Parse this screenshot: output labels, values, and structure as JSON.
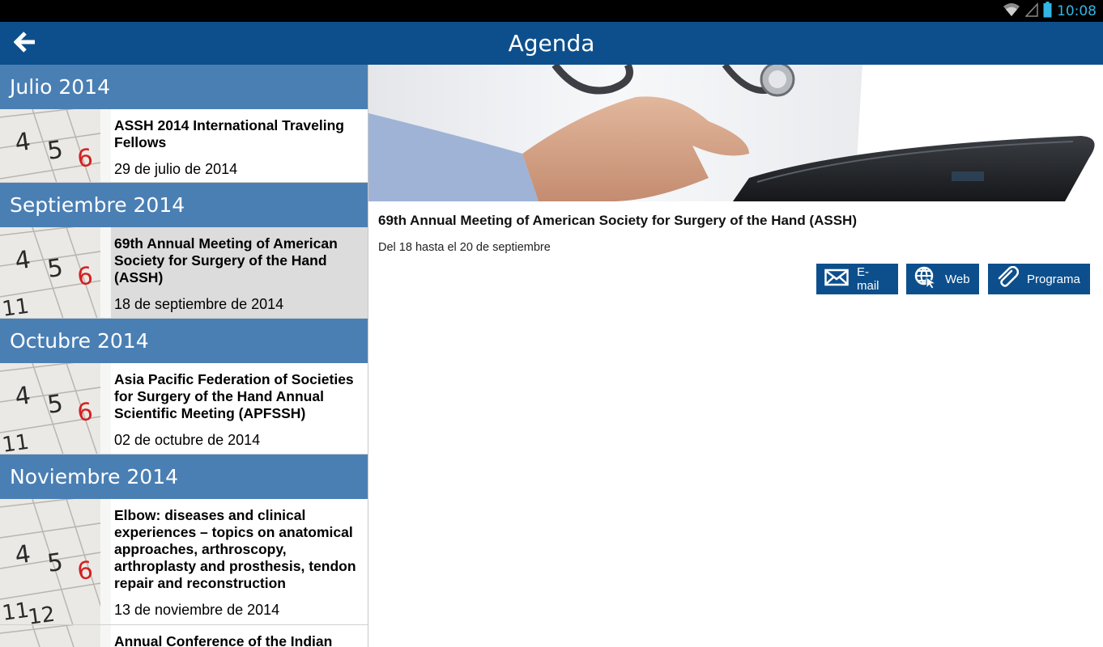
{
  "status_bar": {
    "time": "10:08",
    "icons": [
      "wifi-icon",
      "signal-icon",
      "battery-icon"
    ]
  },
  "app_bar": {
    "title": "Agenda",
    "back_icon": "arrow-left-icon"
  },
  "months": [
    {
      "label": "Julio 2014",
      "events": [
        {
          "title": "ASSH 2014 International Traveling Fellows",
          "date": "29 de julio de 2014",
          "selected": false
        }
      ]
    },
    {
      "label": "Septiembre 2014",
      "events": [
        {
          "title": "69th Annual Meeting of American Society for Surgery of the Hand (ASSH)",
          "date": "18 de septiembre de 2014",
          "selected": true
        }
      ]
    },
    {
      "label": "Octubre 2014",
      "events": [
        {
          "title": "Asia Pacific Federation of Societies for Surgery of the Hand Annual Scientific Meeting (APFSSH)",
          "date": "02 de octubre de 2014",
          "selected": false
        }
      ]
    },
    {
      "label": "Noviembre 2014",
      "events": [
        {
          "title": "Elbow: diseases and clinical experiences – topics on anatomical approaches, arthroscopy, arthroplasty and prosthesis, tendon repair and reconstruction",
          "date": "13 de noviembre de 2014",
          "selected": false
        },
        {
          "title": "Annual Conference of the Indian",
          "date": "",
          "selected": false
        }
      ]
    }
  ],
  "detail": {
    "title": "69th Annual Meeting of American Society for Surgery of the Hand (ASSH)",
    "dates": "Del 18 hasta el 20 de septiembre",
    "buttons": {
      "email": {
        "label": "E-mail",
        "icon": "envelope-icon"
      },
      "web": {
        "label": "Web",
        "icon": "globe-cursor-icon"
      },
      "program": {
        "label": "Programa",
        "icon": "paperclip-icon"
      }
    }
  },
  "colors": {
    "app_bar": "#0d4f8c",
    "month_header": "#4a7fb4",
    "selected_row": "#dcdcdc",
    "status_accent": "#33b5e5"
  }
}
